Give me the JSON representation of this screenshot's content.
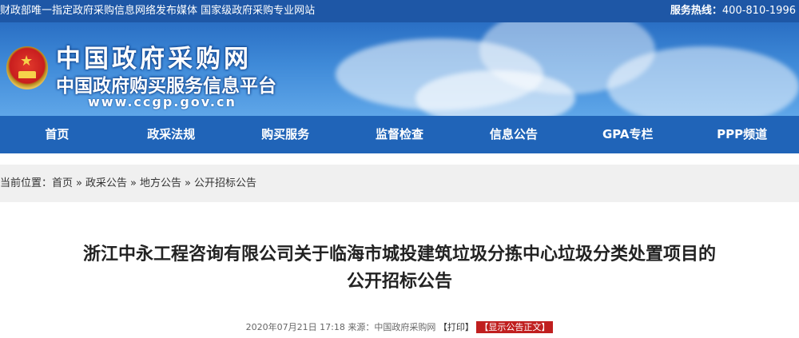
{
  "topbar": {
    "left_text": "财政部唯一指定政府采购信息网络发布媒体 国家级政府采购专业网站",
    "hotline_label": "服务热线：",
    "hotline_number": "400-810-1996"
  },
  "banner": {
    "site_name": "中国政府采购网",
    "site_subtitle": "中国政府购买服务信息平台",
    "site_url": "www.ccgp.gov.cn"
  },
  "nav": {
    "items": [
      "首页",
      "政采法规",
      "购买服务",
      "监督检查",
      "信息公告",
      "GPA专栏",
      "PPP频道"
    ]
  },
  "breadcrumb": {
    "prefix": "当前位置：",
    "items": [
      "首页",
      "政采公告",
      "地方公告",
      "公开招标公告"
    ],
    "separator": "»"
  },
  "article": {
    "title_line1": "浙江中永工程咨询有限公司关于临海市城投建筑垃圾分拣中心垃圾分类处置项目的",
    "title_line2": "公开招标公告",
    "date": "2020年07月21日 17:18",
    "source_label": "来源：",
    "source": "中国政府采购网",
    "print_label": "【打印】",
    "show_text_button": "【显示公告正文】"
  },
  "colors": {
    "topbar_bg": "#1e57a6",
    "nav_bg": "#2064b8",
    "show_button_bg": "#c01f1f",
    "breadcrumb_bg": "#f0f0f0"
  }
}
